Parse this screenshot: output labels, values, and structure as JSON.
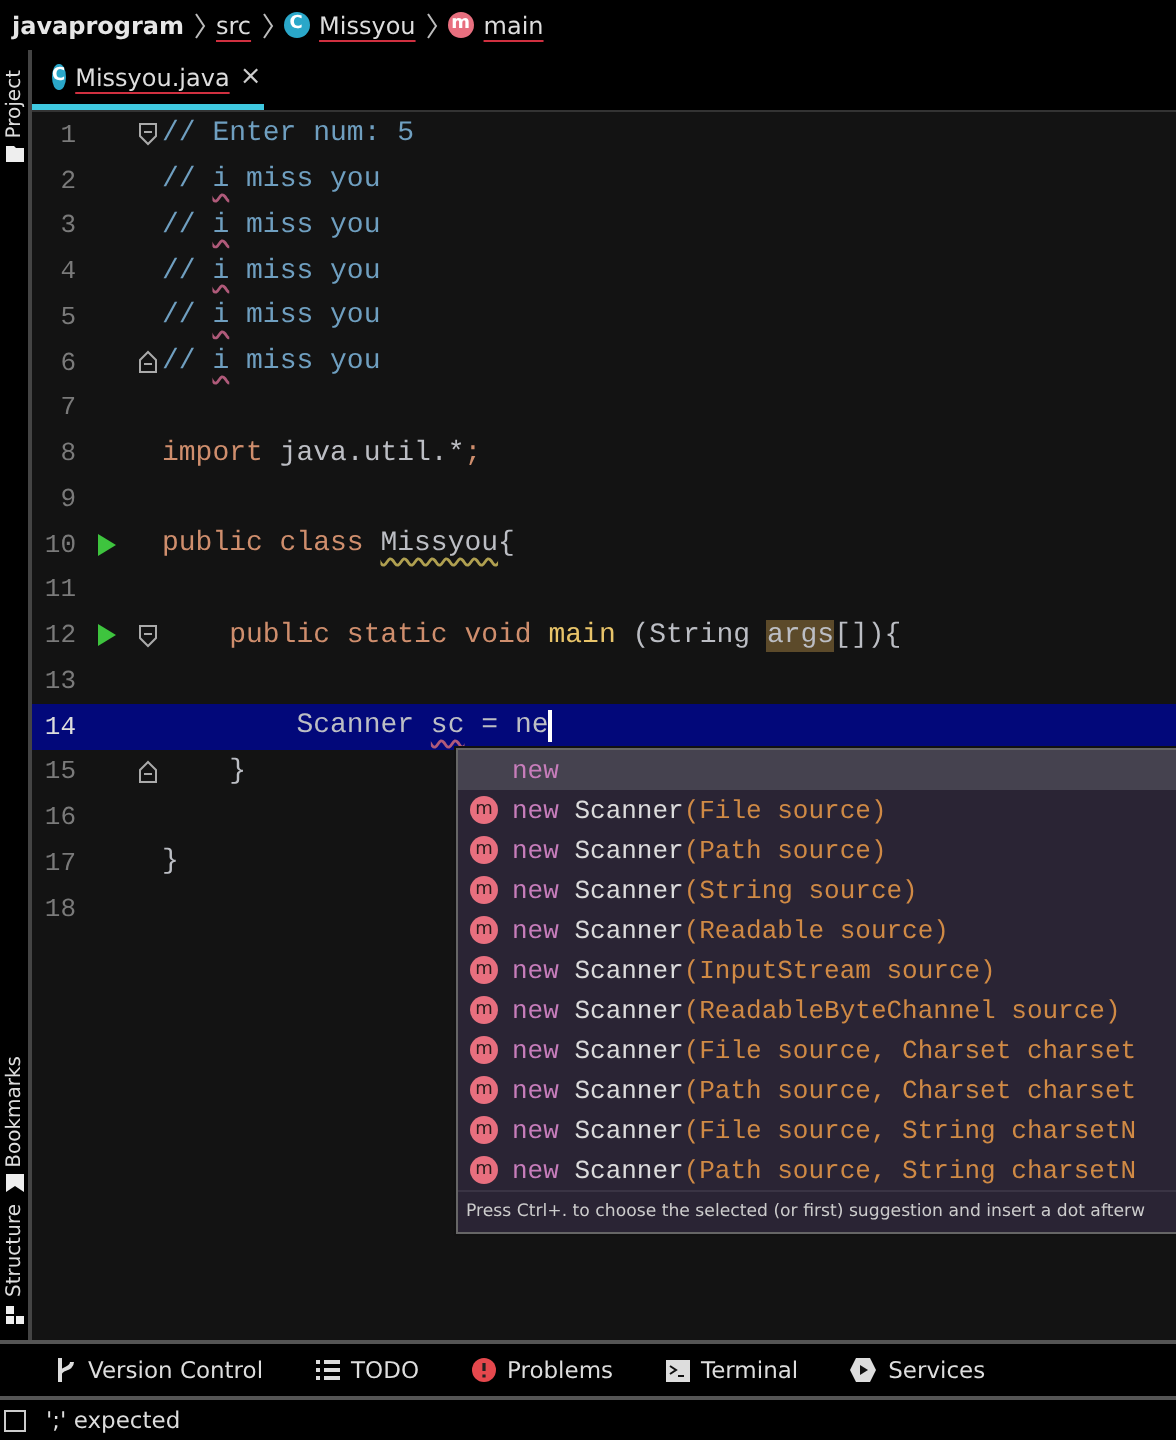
{
  "breadcrumb": [
    {
      "label": "javaprogram"
    },
    {
      "label": "src"
    },
    {
      "label": "Missyou",
      "icon": "C",
      "kind": "class"
    },
    {
      "label": "main",
      "icon": "m",
      "kind": "method"
    }
  ],
  "tool_windows_left": [
    {
      "label": "Project",
      "kind": "folder"
    },
    {
      "label": "Bookmarks",
      "kind": "bookmark"
    },
    {
      "label": "Structure",
      "kind": "structure"
    }
  ],
  "tabs": [
    {
      "label": "Missyou.java",
      "icon": "C",
      "selected": true,
      "close": "×"
    }
  ],
  "lines": [
    {
      "number": "1",
      "fold_start": true,
      "fold_end": false,
      "run": false,
      "current": false,
      "tokens": [
        {
          "text": "// Enter num: 5",
          "kind": "comment"
        }
      ]
    },
    {
      "number": "2",
      "fold_start": false,
      "fold_end": false,
      "run": false,
      "current": false,
      "tokens": [
        {
          "text": "// ",
          "kind": "comment"
        },
        {
          "text": "i",
          "kind": "comment",
          "misspelled": true
        },
        {
          "text": " miss you",
          "kind": "comment"
        }
      ]
    },
    {
      "number": "3",
      "fold_start": false,
      "fold_end": false,
      "run": false,
      "current": false,
      "tokens": [
        {
          "text": "// ",
          "kind": "comment"
        },
        {
          "text": "i",
          "kind": "comment",
          "misspelled": true
        },
        {
          "text": " miss you",
          "kind": "comment"
        }
      ]
    },
    {
      "number": "4",
      "fold_start": false,
      "fold_end": false,
      "run": false,
      "current": false,
      "tokens": [
        {
          "text": "// ",
          "kind": "comment"
        },
        {
          "text": "i",
          "kind": "comment",
          "misspelled": true
        },
        {
          "text": " miss you",
          "kind": "comment"
        }
      ]
    },
    {
      "number": "5",
      "fold_start": false,
      "fold_end": false,
      "run": false,
      "current": false,
      "tokens": [
        {
          "text": "// ",
          "kind": "comment"
        },
        {
          "text": "i",
          "kind": "comment",
          "misspelled": true
        },
        {
          "text": " miss you",
          "kind": "comment"
        }
      ]
    },
    {
      "number": "6",
      "fold_start": false,
      "fold_end": true,
      "run": false,
      "current": false,
      "tokens": [
        {
          "text": "// ",
          "kind": "comment"
        },
        {
          "text": "i",
          "kind": "comment",
          "misspelled": true
        },
        {
          "text": " miss you",
          "kind": "comment"
        }
      ]
    },
    {
      "number": "7",
      "fold_start": false,
      "fold_end": false,
      "run": false,
      "current": false
    },
    {
      "number": "8",
      "fold_start": false,
      "fold_end": false,
      "run": false,
      "current": false,
      "tokens": [
        {
          "text": "import",
          "kind": "keyword"
        },
        {
          "text": " java.util.*",
          "kind": "plain"
        },
        {
          "text": ";",
          "kind": "keyword"
        }
      ]
    },
    {
      "number": "9",
      "fold_start": false,
      "fold_end": false,
      "run": false,
      "current": false
    },
    {
      "number": "10",
      "fold_start": false,
      "fold_end": false,
      "run": true,
      "current": false,
      "tokens": [
        {
          "text": "public class ",
          "kind": "keyword"
        },
        {
          "text": "Missyou",
          "kind": "plain",
          "warning": true
        },
        {
          "text": "{",
          "kind": "plain"
        }
      ]
    },
    {
      "number": "11",
      "fold_start": false,
      "fold_end": false,
      "run": false,
      "current": false
    },
    {
      "number": "12",
      "fold_start": true,
      "fold_end": false,
      "run": true,
      "current": false,
      "tokens": [
        {
          "text": "    public static void ",
          "kind": "keyword"
        },
        {
          "text": "main ",
          "kind": "method"
        },
        {
          "text": "(String ",
          "kind": "plain"
        },
        {
          "text": "args",
          "kind": "highlight"
        },
        {
          "text": "[]){",
          "kind": "plain"
        }
      ]
    },
    {
      "number": "13",
      "fold_start": false,
      "fold_end": false,
      "run": false,
      "current": false
    },
    {
      "number": "14",
      "fold_start": false,
      "fold_end": false,
      "run": false,
      "current": true,
      "tokens": [
        {
          "text": "        Scanner ",
          "kind": "plain"
        },
        {
          "text": "sc",
          "kind": "variable",
          "misspelled": true
        },
        {
          "text": " = ne",
          "kind": "plain"
        }
      ]
    },
    {
      "number": "15",
      "fold_start": false,
      "fold_end": true,
      "run": false,
      "current": false,
      "tokens": [
        {
          "text": "    }",
          "kind": "plain"
        }
      ]
    },
    {
      "number": "16",
      "fold_start": false,
      "fold_end": false,
      "run": false,
      "current": false
    },
    {
      "number": "17",
      "fold_start": false,
      "fold_end": false,
      "run": false,
      "current": false,
      "tokens": [
        {
          "text": "}",
          "kind": "plain"
        }
      ]
    },
    {
      "number": "18",
      "fold_start": false,
      "fold_end": false,
      "run": false,
      "current": false
    }
  ],
  "completion": {
    "items": [
      {
        "kind": "keyword",
        "keyword": "new",
        "selected": true
      },
      {
        "kind": "constructor",
        "icon": "m",
        "keyword": "new",
        "name": "Scanner",
        "params": "(File source)",
        "selected": false
      },
      {
        "kind": "constructor",
        "icon": "m",
        "keyword": "new",
        "name": "Scanner",
        "params": "(Path source)",
        "selected": false
      },
      {
        "kind": "constructor",
        "icon": "m",
        "keyword": "new",
        "name": "Scanner",
        "params": "(String source)",
        "selected": false
      },
      {
        "kind": "constructor",
        "icon": "m",
        "keyword": "new",
        "name": "Scanner",
        "params": "(Readable source)",
        "selected": false
      },
      {
        "kind": "constructor",
        "icon": "m",
        "keyword": "new",
        "name": "Scanner",
        "params": "(InputStream source)",
        "selected": false
      },
      {
        "kind": "constructor",
        "icon": "m",
        "keyword": "new",
        "name": "Scanner",
        "params": "(ReadableByteChannel source)",
        "selected": false
      },
      {
        "kind": "constructor",
        "icon": "m",
        "keyword": "new",
        "name": "Scanner",
        "params": "(File source, Charset charset",
        "selected": false
      },
      {
        "kind": "constructor",
        "icon": "m",
        "keyword": "new",
        "name": "Scanner",
        "params": "(Path source, Charset charset",
        "selected": false
      },
      {
        "kind": "constructor",
        "icon": "m",
        "keyword": "new",
        "name": "Scanner",
        "params": "(File source, String charsetN",
        "selected": false
      },
      {
        "kind": "constructor",
        "icon": "m",
        "keyword": "new",
        "name": "Scanner",
        "params": "(Path source, String charsetN",
        "selected": false
      }
    ],
    "hint": "Press Ctrl+. to choose the selected (or first) suggestion and insert a dot afterw"
  },
  "bottom_tools": [
    {
      "label": "Version Control",
      "kind": "vcs"
    },
    {
      "label": "TODO",
      "kind": "list"
    },
    {
      "label": "Problems",
      "kind": "problems"
    },
    {
      "label": "Terminal",
      "kind": "terminal"
    },
    {
      "label": "Services",
      "kind": "services"
    }
  ],
  "status": "';' expected"
}
